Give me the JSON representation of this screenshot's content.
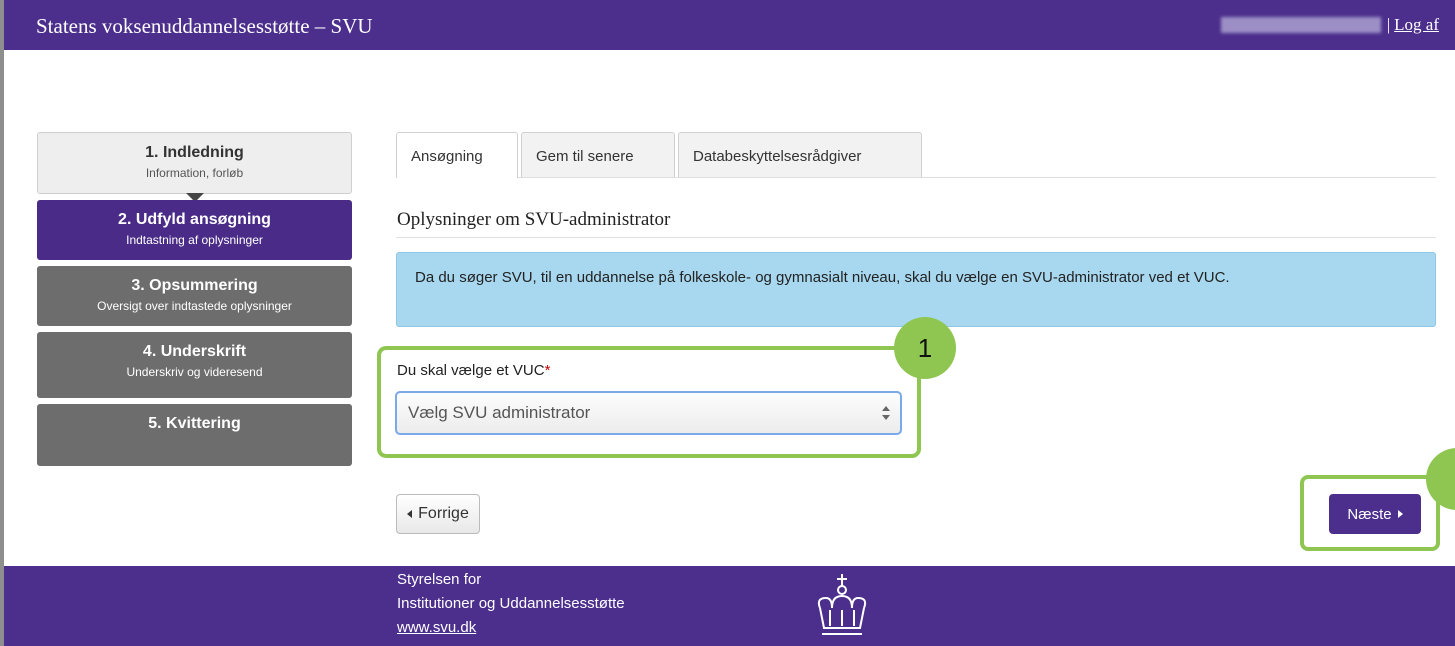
{
  "header": {
    "site_title": "Statens voksenuddannelsesstøtte – SVU",
    "separator": "|",
    "logout_label": "Log af"
  },
  "steps": [
    {
      "title": "1. Indledning",
      "subtitle": "Information, forløb"
    },
    {
      "title": "2. Udfyld ansøgning",
      "subtitle": "Indtastning af oplysninger"
    },
    {
      "title": "3. Opsummering",
      "subtitle": "Oversigt over indtastede oplysninger"
    },
    {
      "title": "4. Underskrift",
      "subtitle": "Underskriv og videresend"
    },
    {
      "title": "5. Kvittering",
      "subtitle": ""
    }
  ],
  "tabs": [
    {
      "label": "Ansøgning"
    },
    {
      "label": "Gem til senere"
    },
    {
      "label": "Databeskyttelsesrådgiver"
    }
  ],
  "section": {
    "title": "Oplysninger om SVU-administrator",
    "info_text": "Da du søger SVU, til en uddannelse på folkeskole- og gymnasialt niveau, skal du vælge en SVU-administrator ved et VUC."
  },
  "form": {
    "vuc_label": "Du skal vælge et VUC",
    "required_mark": "*",
    "select_value": "Vælg SVU administrator"
  },
  "annotations": {
    "badge_1": "1"
  },
  "nav": {
    "prev_label": "Forrige",
    "next_label": "Næste"
  },
  "footer": {
    "line1": "Styrelsen for",
    "line2": "Institutioner og Uddannelsesstøtte",
    "link": "www.svu.dk"
  },
  "colors": {
    "brand_purple": "#4c2f8c",
    "info_blue": "#a8d8ef",
    "callout_green": "#8fc651",
    "step_gray": "#6d6d6d"
  },
  "icons": {
    "crown": "crown-icon",
    "select_arrows": "updown-icon",
    "prev": "caret-left-icon",
    "next": "caret-right-icon"
  }
}
